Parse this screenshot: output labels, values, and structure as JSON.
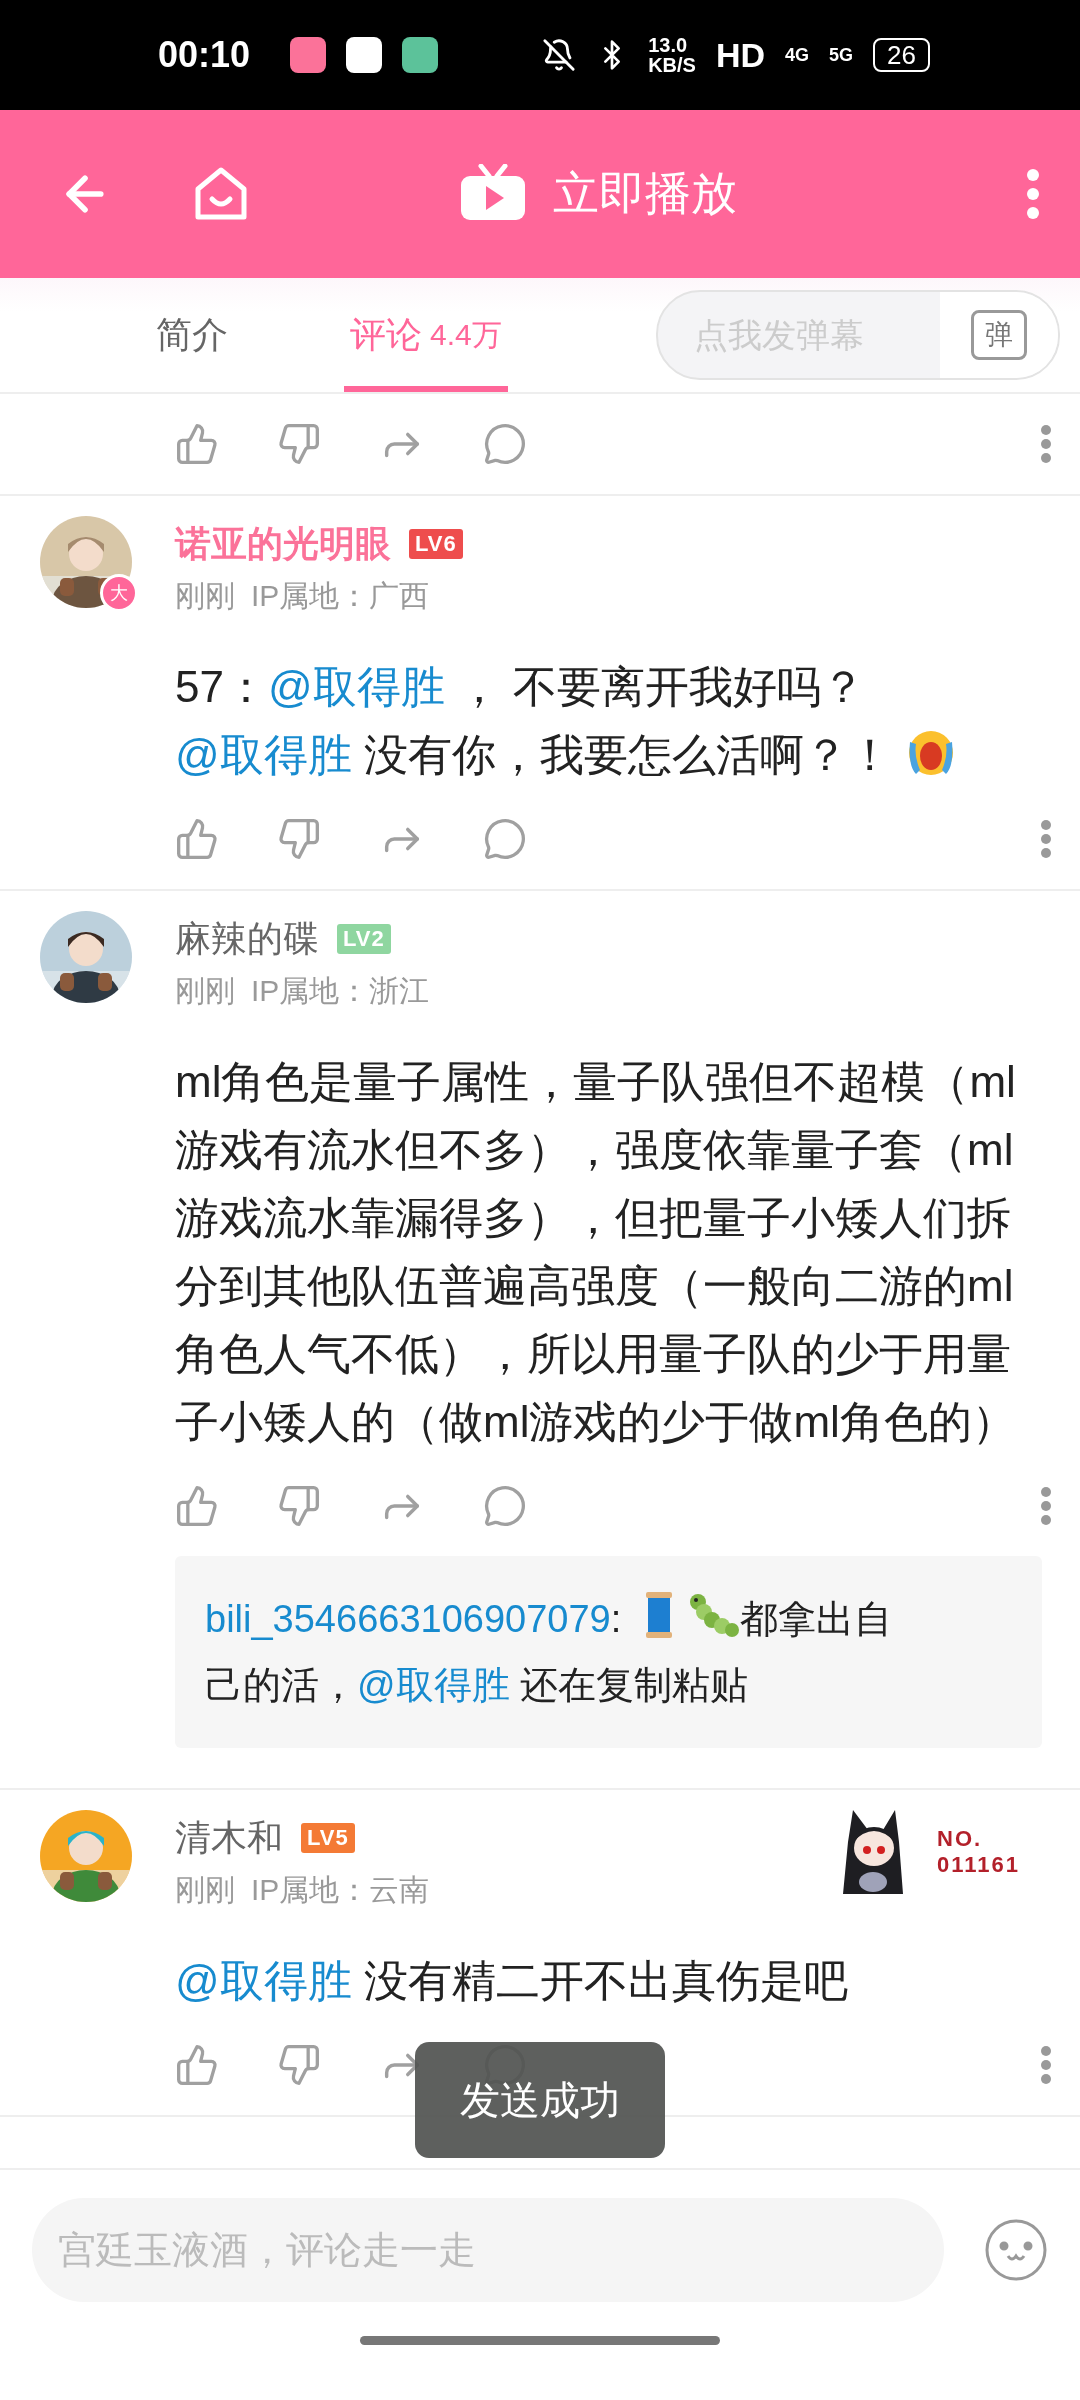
{
  "status_bar": {
    "time": "00:10",
    "net_speed": "13.0",
    "net_unit": "KB/S",
    "hd": "HD",
    "sim1": "4G",
    "sim2": "5G",
    "battery": "26"
  },
  "header": {
    "title": "立即播放"
  },
  "tabs": [
    {
      "label": "简介",
      "selected": false
    },
    {
      "label": "评论",
      "count": "4.4万",
      "selected": true
    }
  ],
  "danmaku": {
    "placeholder": "点我发弹幕",
    "button": "弹"
  },
  "comments": [
    {
      "name": "诺亚的光明眼",
      "vip": true,
      "level": "LV6",
      "color": "#ee4d4d",
      "avatar_badge": "大",
      "time": "刚刚",
      "ip": "IP属地：广西",
      "body": [
        [
          {
            "kind": "plain",
            "text": "57："
          },
          {
            "kind": "mention",
            "text": "@取得胜"
          },
          {
            "kind": "plain",
            "text": " ， 不要离开我好吗？"
          }
        ],
        [
          {
            "kind": "mention",
            "text": "@取得胜"
          },
          {
            "kind": "plain",
            "text": " 没有你，我要怎么活啊？！ "
          },
          {
            "kind": "cry"
          }
        ]
      ]
    },
    {
      "name": "麻辣的碟",
      "vip": false,
      "level": "LV2",
      "color": "#8fd6a0",
      "time": "刚刚",
      "ip": "IP属地：浙江",
      "body": [
        [
          {
            "kind": "plain",
            "text": "ml角色是量子属性，量子队强但不超模（ml游戏有流水但不多），强度依靠量子套（ml游戏流水靠漏得多），但把量子小矮人们拆分到其他队伍普遍高强度（一般向二游的ml角色人气不低），所以用量子队的少于用量子小矮人的（做ml游戏的少于做ml角色的）"
          }
        ]
      ],
      "reply": {
        "author": "bili_3546663106907079",
        "segments": [
          {
            "kind": "plain",
            "text": ": "
          },
          {
            "kind": "spool"
          },
          {
            "kind": "bug"
          },
          {
            "kind": "plain",
            "text": "都拿出自"
          },
          {
            "kind": "plain",
            "text": "己的活，"
          },
          {
            "kind": "mention",
            "text": "@取得胜"
          },
          {
            "kind": "plain",
            "text": " 还在复制粘贴"
          }
        ]
      }
    },
    {
      "name": "清木和",
      "vip": false,
      "level": "LV5",
      "color": "#f47a35",
      "time": "刚刚",
      "ip": "IP属地：云南",
      "decoration": {
        "kind": "picture",
        "label": "NO.",
        "number": "011161"
      },
      "body": [
        [
          {
            "kind": "mention",
            "text": "@取得胜"
          },
          {
            "kind": "plain",
            "text": " 没有精二开不出真伤是吧"
          }
        ]
      ]
    }
  ],
  "input": {
    "placeholder": "宫廷玉液酒，评论走一走"
  },
  "toast": {
    "text": "发送成功"
  }
}
